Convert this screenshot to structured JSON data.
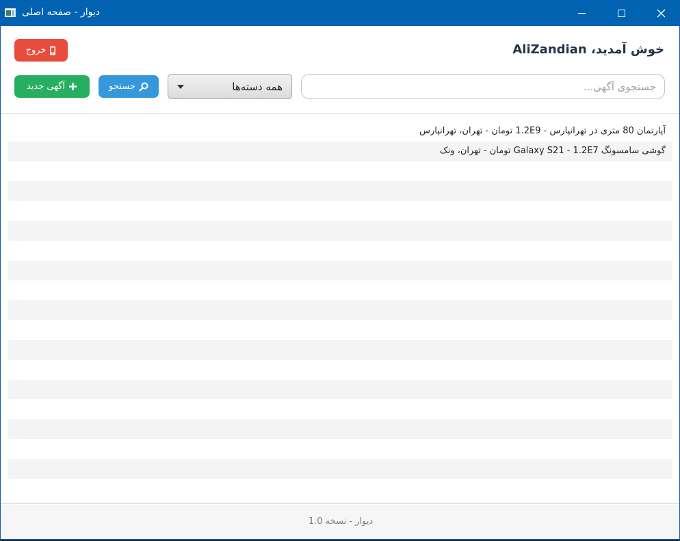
{
  "window": {
    "title": "دیوار - صفحه اصلی",
    "icon": "app-window-icon",
    "controls": [
      "minimize",
      "maximize",
      "close"
    ]
  },
  "header": {
    "welcome": "خوش آمدید، AliZandian",
    "logout_label": "خروج",
    "logout_icon": "phone-icon"
  },
  "toolbar": {
    "search_placeholder": "جستجوی آگهی...",
    "category_selected": "همه دسته‌ها",
    "search_label": "جستجو",
    "search_icon": "magnifier-icon",
    "new_ad_label": "آگهی جدید",
    "new_ad_icon": "plus-icon"
  },
  "listings": [
    {
      "text": "آپارتمان 80 متری در تهرانپارس - 1.2E9 تومان - تهران، تهرانپارس"
    },
    {
      "text": "گوشی سامسونگ Galaxy S21 - 1.2E7 تومان - تهران، ونک"
    }
  ],
  "footer": {
    "text": "دیوار - نسخه 1.0"
  },
  "colors": {
    "titlebar": "#0063b1",
    "logout": "#e74c3c",
    "new_ad": "#27ae60",
    "search": "#3498db"
  }
}
